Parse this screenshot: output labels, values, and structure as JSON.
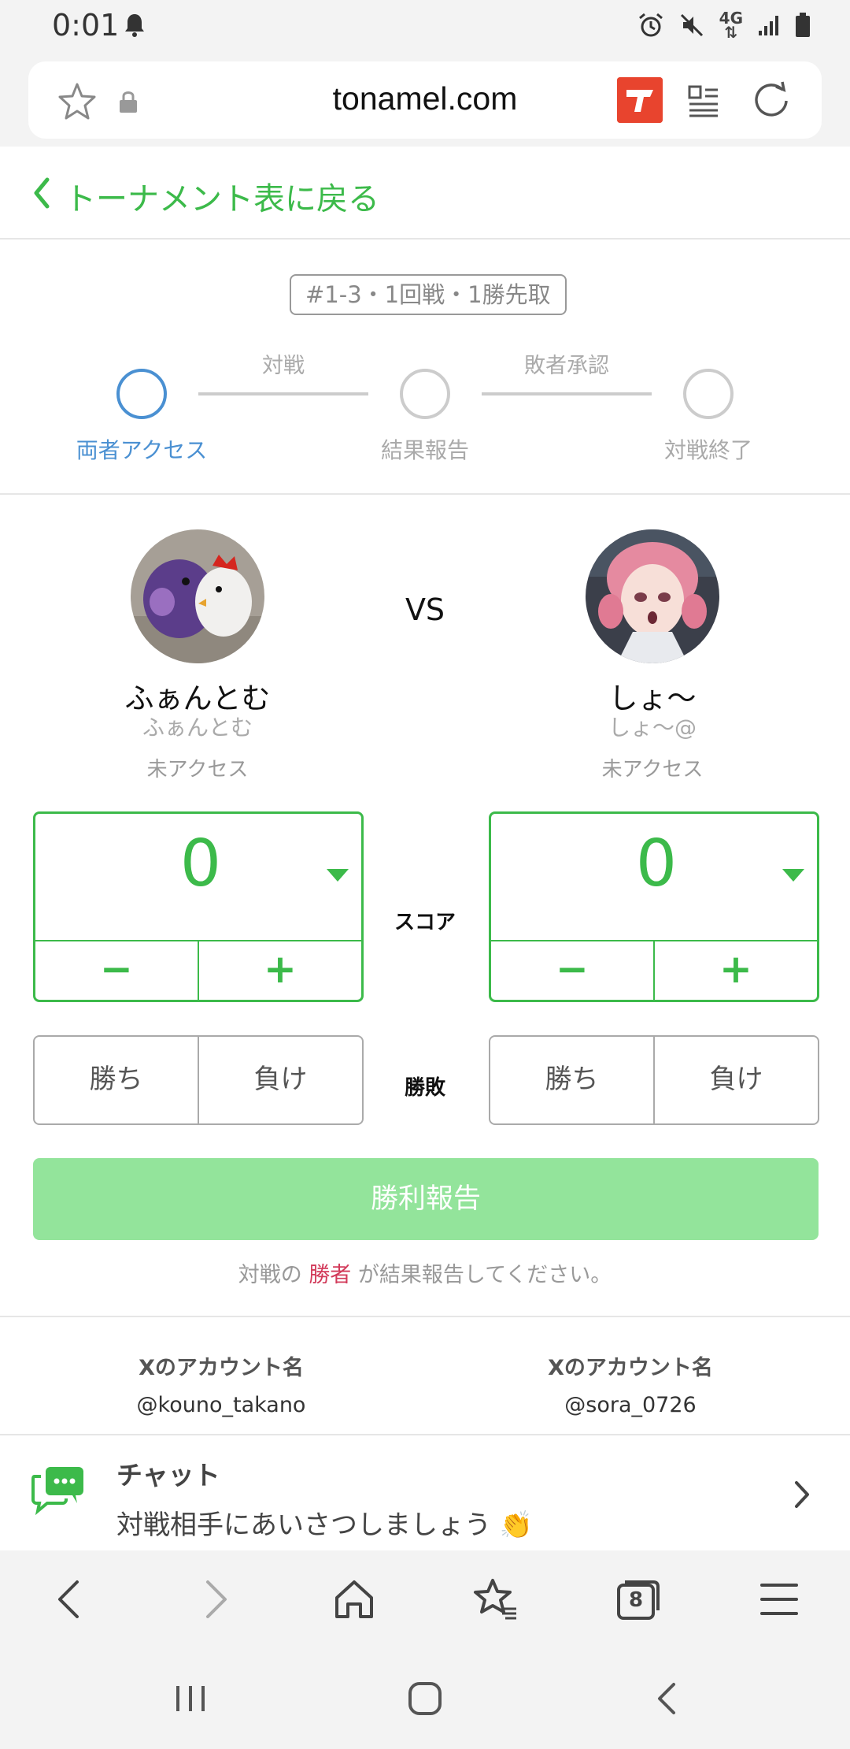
{
  "status_bar": {
    "time": "0:01",
    "network": "4G"
  },
  "browser": {
    "url": "tonamel.com"
  },
  "back_link": {
    "label": "トーナメント表に戻る"
  },
  "match": {
    "tag": "#1-3・1回戦・1勝先取",
    "steps": [
      {
        "label": "両者アクセス",
        "active": true
      },
      {
        "label": "結果報告",
        "active": false
      },
      {
        "label": "対戦終了",
        "active": false
      }
    ],
    "connectors": [
      "対戦",
      "敗者承認"
    ]
  },
  "players": [
    {
      "name": "ふぁんとむ",
      "sub": "ふぁんとむ",
      "status": "未アクセス",
      "score": "0",
      "win_label": "勝ち",
      "lose_label": "負け",
      "x_account": "@kouno_takano"
    },
    {
      "name": "しょ〜",
      "sub": "しょ〜@",
      "status": "未アクセス",
      "score": "0",
      "win_label": "勝ち",
      "lose_label": "負け",
      "x_account": "@sora_0726"
    }
  ],
  "vs_label": "VS",
  "score_label": "スコア",
  "result_label": "勝敗",
  "score_minus": "−",
  "score_plus": "+",
  "report_button": "勝利報告",
  "hint": {
    "before": "対戦の ",
    "winner": "勝者",
    "after": " が結果報告してください。"
  },
  "x_account_label": "Xのアカウント名",
  "chat": {
    "title": "チャット",
    "message": "対戦相手にあいさつしましょう 👏"
  },
  "toolbar": {
    "tabs_count": "8"
  },
  "colors": {
    "accent": "#3cba4a",
    "accent_light": "#93e49b",
    "step_active": "#4a90d2",
    "winner": "#d23a5a"
  }
}
